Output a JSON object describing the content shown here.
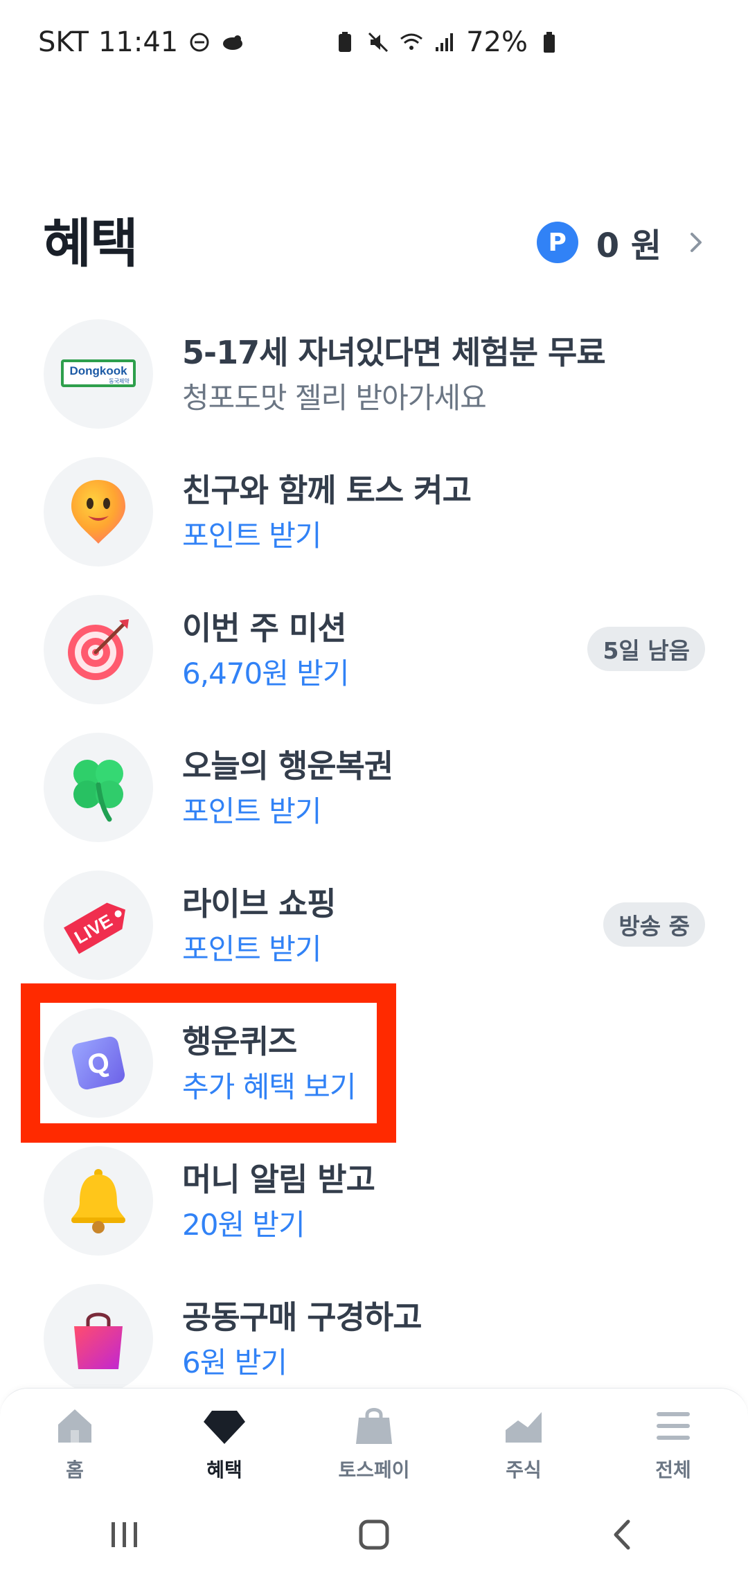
{
  "status_bar": {
    "carrier": "SKT",
    "time": "11:41",
    "battery": "72%"
  },
  "header": {
    "title": "혜택",
    "point_badge": "P",
    "point_amount": "0 원"
  },
  "benefits": [
    {
      "title": "5-17세 자녀있다면 체험분 무료",
      "subtitle": "청포도맛 젤리 받아가세요",
      "subtitle_style": "gray",
      "tag": "",
      "icon": "dongkook-logo",
      "logo_text": "Dongkook",
      "logo_sub": "동국제약"
    },
    {
      "title": "친구와 함께 토스 켜고",
      "subtitle": "포인트 받기",
      "subtitle_style": "blue",
      "tag": "",
      "icon": "smiley-pin-icon"
    },
    {
      "title": "이번 주 미션",
      "subtitle": "6,470원 받기",
      "subtitle_style": "blue",
      "tag": "5일 남음",
      "icon": "target-icon"
    },
    {
      "title": "오늘의 행운복권",
      "subtitle": "포인트 받기",
      "subtitle_style": "blue",
      "tag": "",
      "icon": "clover-icon"
    },
    {
      "title": "라이브 쇼핑",
      "subtitle": "포인트 받기",
      "subtitle_style": "blue",
      "tag": "방송 중",
      "icon": "live-tag-icon",
      "icon_text": "LIVE"
    },
    {
      "title": "행운퀴즈",
      "subtitle": "추가 혜택 보기",
      "subtitle_style": "blue",
      "tag": "",
      "icon": "quiz-cube-icon",
      "icon_text": "Q"
    },
    {
      "title": "머니 알림 받고",
      "subtitle": "20원 받기",
      "subtitle_style": "blue",
      "tag": "",
      "icon": "bell-icon"
    },
    {
      "title": "공동구매 구경하고",
      "subtitle": "6원 받기",
      "subtitle_style": "blue",
      "tag": "",
      "icon": "shopping-bag-icon"
    }
  ],
  "bottom_nav": [
    {
      "label": "홈",
      "icon": "home-icon",
      "active": false
    },
    {
      "label": "혜택",
      "icon": "gem-icon",
      "active": true
    },
    {
      "label": "토스페이",
      "icon": "bag-icon",
      "active": false
    },
    {
      "label": "주식",
      "icon": "chart-icon",
      "active": false
    },
    {
      "label": "전체",
      "icon": "menu-icon",
      "active": false
    }
  ],
  "colors": {
    "accent_blue": "#3182f6",
    "highlight_red": "#ff2a00",
    "title_text": "#333d4b"
  }
}
